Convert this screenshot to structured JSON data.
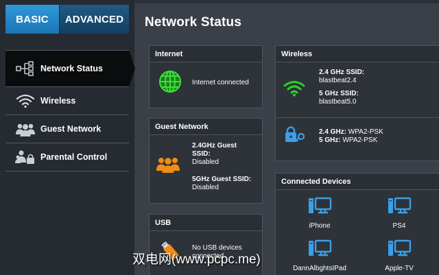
{
  "tabs": {
    "basic": "BASIC",
    "advanced": "ADVANCED"
  },
  "sidebar": {
    "items": [
      {
        "label": "Network Status",
        "icon": "network-tree-icon"
      },
      {
        "label": "Wireless",
        "icon": "wifi-icon"
      },
      {
        "label": "Guest Network",
        "icon": "guest-users-icon"
      },
      {
        "label": "Parental Control",
        "icon": "parental-lock-icon"
      }
    ]
  },
  "page": {
    "title": "Network Status"
  },
  "internet": {
    "title": "Internet",
    "status": "Internet connected",
    "icon": "globe-icon"
  },
  "wireless": {
    "title": "Wireless",
    "ssid24_label": "2.4 GHz SSID:",
    "ssid24_value": "blastbeat2.4",
    "ssid5_label": "5 GHz SSID:",
    "ssid5_value": "blastbeat5.0",
    "sec24_label": "2.4 GHz:",
    "sec24_value": "WPA2-PSK",
    "sec5_label": "5 GHz:",
    "sec5_value": "WPA2-PSK"
  },
  "guest": {
    "title": "Guest Network",
    "ssid24_label_line1": "2.4GHz Guest",
    "ssid24_label_line2": "SSID:",
    "ssid24_value": "Disabled",
    "ssid5_label": "5GHz Guest SSID:",
    "ssid5_value": "Disabled"
  },
  "usb": {
    "title": "USB",
    "status_line1": "No USB devices",
    "status_line2": "connected"
  },
  "devices": {
    "title": "Connected Devices",
    "items": [
      "iPhone",
      "PS4",
      "DannAlbghtsIPad",
      "Apple-TV"
    ]
  },
  "watermark": "双电网(www.pcpc.me)",
  "colors": {
    "accent_blue": "#2f9ad8",
    "wifi_green": "#2bd12b",
    "guest_orange": "#f28c16",
    "device_blue": "#3aa0e8"
  }
}
